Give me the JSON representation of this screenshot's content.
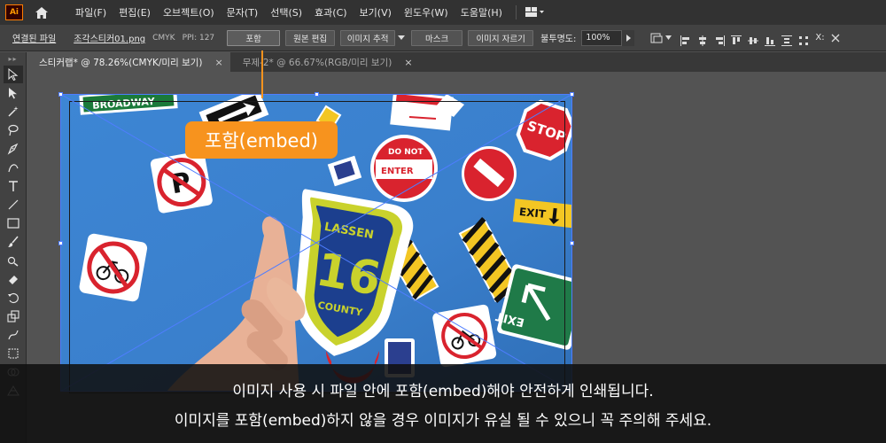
{
  "app": {
    "logo_text": "Ai"
  },
  "menu": {
    "items": [
      "파일(F)",
      "편집(E)",
      "오브젝트(O)",
      "문자(T)",
      "선택(S)",
      "효과(C)",
      "보기(V)",
      "윈도우(W)",
      "도움말(H)"
    ]
  },
  "control": {
    "linked_file_label": "연결된 파일",
    "filename": "조각스티커01.png",
    "color_mode": "CMYK",
    "ppi": "PPI: 127",
    "embed_button": "포함",
    "edit_original_button": "원본 편집",
    "image_trace_button": "이미지 추적",
    "mask_button": "마스크",
    "crop_image_button": "이미지 자르기",
    "opacity_label": "불투명도:",
    "opacity_value": "100%",
    "x_label": "X:"
  },
  "tabs": [
    {
      "label": "스티커랩* @ 78.26%(CMYK/미리 보기)",
      "close": "×"
    },
    {
      "label": "무제-2* @ 66.67%(RGB/미리 보기)",
      "close": "×"
    }
  ],
  "photo": {
    "stickers": {
      "broadway": "BROADWAY",
      "stop": "STOP",
      "do_not_enter_line1": "DO NOT",
      "do_not_enter_line2": "ENTER",
      "exit": "EXIT",
      "lassen": "LASSEN",
      "route_number": "16",
      "county": "COUNTY",
      "exit_green": "EXIT",
      "parking": "P"
    },
    "colors": {
      "background": "#3a7fcc",
      "accent": "#f7931e",
      "selection": "#4f7dff"
    }
  },
  "callout": {
    "label": "포함(embed)"
  },
  "caption": {
    "line1": "이미지 사용 시 파일 안에 포함(embed)해야 안전하게 인쇄됩니다.",
    "line2": "이미지를 포함(embed)하지 않을 경우 이미지가 유실 될 수 있으니 꼭 주의해 주세요."
  }
}
